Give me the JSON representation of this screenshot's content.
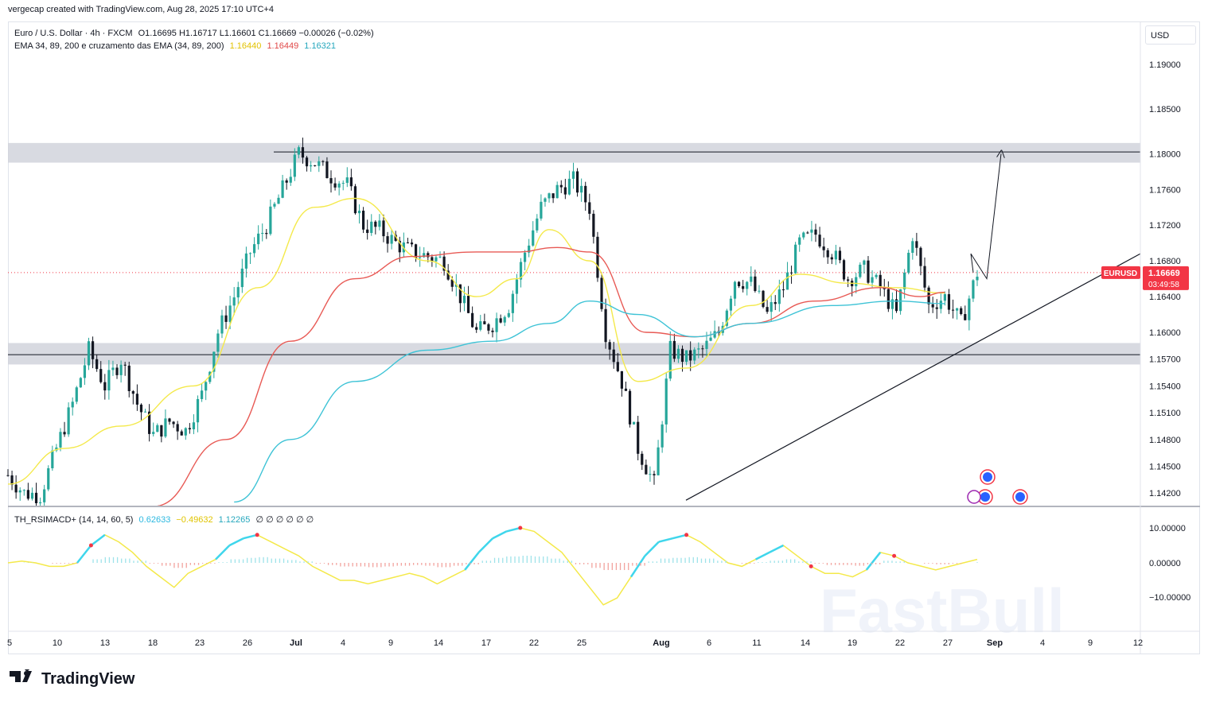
{
  "header": {
    "text": "vergecap created with TradingView.com, Aug 28, 2025 17:10 UTC+4"
  },
  "footer": {
    "brand": "TradingView"
  },
  "currency": "USD",
  "legend_price": {
    "symbol": "Euro / U.S. Dollar · 4h · FXCM",
    "ohlc": "O1.16695  H1.16717  L1.16601  C1.16669  −0.00026 (−0.02%)",
    "ema_label": "EMA 34, 89, 200 e cruzamento das EMA (34, 89, 200)",
    "ema_values": [
      "1.16440",
      "1.16449",
      "1.16321"
    ]
  },
  "legend_osc": {
    "label": "TH_RSIMACD+ (14, 14, 60, 5)",
    "values": [
      "0.62633",
      "−0.49632",
      "1.12265"
    ],
    "extras": "∅ ∅ ∅ ∅ ∅ ∅"
  },
  "price_tag": {
    "symbol": "EURUSD",
    "price": "1.16669",
    "countdown": "03:49:58"
  },
  "watermark": "FastBull",
  "colors": {
    "ema34": "#f4e94a",
    "ema89": "#e85a55",
    "ema200": "#3ec3d6",
    "bull": "#26a69a",
    "bear": "#131722",
    "price_tag": "#f23645"
  },
  "chart_data": {
    "type": "line",
    "title": "Euro / U.S. Dollar · 4h · FXCM",
    "xlabel": "",
    "ylabel": "",
    "x_ticks": [
      "5",
      "10",
      "13",
      "18",
      "23",
      "26",
      "Jul",
      "4",
      "9",
      "14",
      "17",
      "22",
      "25",
      "Aug",
      "6",
      "11",
      "14",
      "19",
      "22",
      "27",
      "Sep",
      "4",
      "9",
      "12"
    ],
    "y_ticks": [
      "1.19000",
      "1.18500",
      "1.18000",
      "1.17600",
      "1.17200",
      "1.16800",
      "1.16400",
      "1.16000",
      "1.15700",
      "1.15400",
      "1.15100",
      "1.14800",
      "1.14500",
      "1.14200"
    ],
    "ylim": [
      1.1412,
      1.1925
    ],
    "last_price": 1.16669,
    "zones": [
      {
        "name": "resistance",
        "from": 1.179,
        "to": 1.1812
      },
      {
        "name": "support",
        "from": 1.1564,
        "to": 1.1588
      }
    ],
    "levels": [
      1.1802,
      1.1575
    ],
    "close_series": [
      [
        "Jun 5",
        1.144
      ],
      [
        "Jun 6",
        1.142
      ],
      [
        "Jun 9",
        1.1418
      ],
      [
        "Jun 10",
        1.147
      ],
      [
        "Jun 11",
        1.152
      ],
      [
        "Jun 12",
        1.158
      ],
      [
        "Jun 13",
        1.154
      ],
      [
        "Jun 16",
        1.157
      ],
      [
        "Jun 17",
        1.152
      ],
      [
        "Jun 18",
        1.1485
      ],
      [
        "Jun 19",
        1.15
      ],
      [
        "Jun 20",
        1.149
      ],
      [
        "Jun 23",
        1.153
      ],
      [
        "Jun 24",
        1.16
      ],
      [
        "Jun 25",
        1.164
      ],
      [
        "Jun 26",
        1.169
      ],
      [
        "Jun 27",
        1.172
      ],
      [
        "Jun 30",
        1.176
      ],
      [
        "Jul 1",
        1.18
      ],
      [
        "Jul 2",
        1.179
      ],
      [
        "Jul 3",
        1.1775
      ],
      [
        "Jul 4",
        1.1765
      ],
      [
        "Jul 7",
        1.172
      ],
      [
        "Jul 8",
        1.1715
      ],
      [
        "Jul 9",
        1.17
      ],
      [
        "Jul 10",
        1.169
      ],
      [
        "Jul 11",
        1.1685
      ],
      [
        "Jul 14",
        1.168
      ],
      [
        "Jul 15",
        1.164
      ],
      [
        "Jul 16",
        1.16
      ],
      [
        "Jul 17",
        1.161
      ],
      [
        "Jul 18",
        1.163
      ],
      [
        "Jul 21",
        1.169
      ],
      [
        "Jul 22",
        1.174
      ],
      [
        "Jul 23",
        1.176
      ],
      [
        "Jul 24",
        1.177
      ],
      [
        "Jul 25",
        1.174
      ],
      [
        "Jul 28",
        1.16
      ],
      [
        "Jul 29",
        1.1545
      ],
      [
        "Jul 30",
        1.147
      ],
      [
        "Jul 31",
        1.143
      ],
      [
        "Aug 1",
        1.158
      ],
      [
        "Aug 4",
        1.157
      ],
      [
        "Aug 5",
        1.158
      ],
      [
        "Aug 6",
        1.16
      ],
      [
        "Aug 7",
        1.166
      ],
      [
        "Aug 8",
        1.1655
      ],
      [
        "Aug 11",
        1.162
      ],
      [
        "Aug 12",
        1.165
      ],
      [
        "Aug 13",
        1.17
      ],
      [
        "Aug 14",
        1.171
      ],
      [
        "Aug 15",
        1.169
      ],
      [
        "Aug 18",
        1.166
      ],
      [
        "Aug 19",
        1.167
      ],
      [
        "Aug 20",
        1.165
      ],
      [
        "Aug 21",
        1.162
      ],
      [
        "Aug 22",
        1.171
      ],
      [
        "Aug 25",
        1.163
      ],
      [
        "Aug 26",
        1.164
      ],
      [
        "Aug 27",
        1.161
      ],
      [
        "Aug 28",
        1.16669
      ]
    ],
    "ema_series": [
      {
        "name": "34",
        "values": [
          [
            1.143,
            0
          ],
          [
            1.147,
            7
          ],
          [
            1.1495,
            14
          ],
          [
            1.154,
            23
          ],
          [
            1.165,
            31
          ],
          [
            1.174,
            38
          ],
          [
            1.175,
            43
          ],
          [
            1.168,
            52
          ],
          [
            1.164,
            58
          ],
          [
            1.166,
            63
          ],
          [
            1.1715,
            67
          ],
          [
            1.168,
            72
          ],
          [
            1.1545,
            78
          ],
          [
            1.156,
            84
          ],
          [
            1.163,
            92
          ],
          [
            1.1665,
            98
          ],
          [
            1.1655,
            104
          ],
          [
            1.165,
            110
          ],
          [
            1.1644,
            116
          ]
        ]
      },
      {
        "name": "89",
        "values": [
          [
            1.14,
            18
          ],
          [
            1.148,
            27
          ],
          [
            1.159,
            35
          ],
          [
            1.166,
            43
          ],
          [
            1.1685,
            50
          ],
          [
            1.169,
            58
          ],
          [
            1.169,
            63
          ],
          [
            1.1695,
            68
          ],
          [
            1.169,
            72
          ],
          [
            1.16,
            79
          ],
          [
            1.1595,
            85
          ],
          [
            1.161,
            92
          ],
          [
            1.1635,
            100
          ],
          [
            1.165,
            108
          ],
          [
            1.164,
            113
          ],
          [
            1.16449,
            116
          ]
        ]
      },
      {
        "name": "200",
        "values": [
          [
            1.141,
            28
          ],
          [
            1.148,
            35
          ],
          [
            1.1545,
            43
          ],
          [
            1.158,
            52
          ],
          [
            1.159,
            60
          ],
          [
            1.161,
            67
          ],
          [
            1.1635,
            72
          ],
          [
            1.162,
            78
          ],
          [
            1.1595,
            85
          ],
          [
            1.161,
            92
          ],
          [
            1.163,
            102
          ],
          [
            1.1635,
            110
          ],
          [
            1.16321,
            116
          ]
        ]
      }
    ],
    "trendline": [
      [
        "Jul 31",
        1.1412
      ],
      [
        "Sep 12",
        1.1688
      ]
    ],
    "projection": [
      1.16669,
      1.1688,
      1.166,
      1.18
    ],
    "oscillator": {
      "ylim": [
        -15,
        15
      ],
      "y_ticks": [
        "10.00000",
        "0.00000",
        "−10.00000"
      ]
    }
  }
}
